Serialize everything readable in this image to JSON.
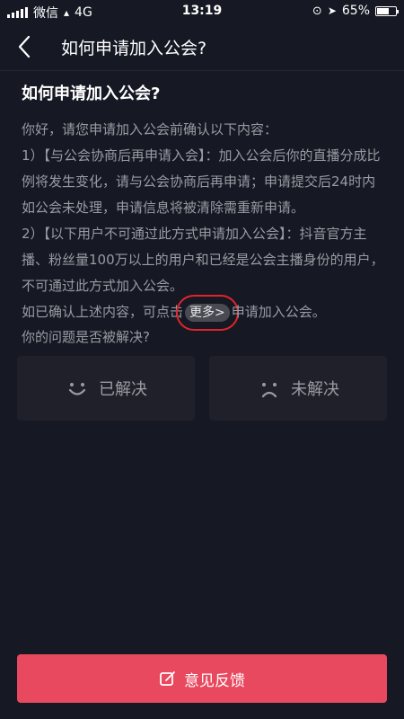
{
  "status_bar": {
    "carrier": "微信",
    "network": "4G",
    "time": "13:19",
    "battery": "65%",
    "battery_fraction": 0.65
  },
  "nav": {
    "title": "如何申请加入公会?"
  },
  "article": {
    "title": "如何申请加入公会?",
    "intro": "你好，请您申请加入公会前确认以下内容：",
    "item1": "1）【与公会协商后再申请入会】：加入公会后你的直播分成比例将发生变化，请与公会协商后再申请；申请提交后24时内如公会未处理，申请信息将被清除需重新申请。",
    "item2": "2）【以下用户不可通过此方式申请加入公会】：抖音官方主播、粉丝量100万以上的用户和已经是公会主播身份的用户，不可通过此方式加入公会。",
    "confirm_prefix": "如已确认上述内容，可点击",
    "more_link": "更多>",
    "confirm_suffix": "申请加入公会。"
  },
  "feedback": {
    "question": "你的问题是否被解决?",
    "resolved_label": "已解决",
    "unresolved_label": "未解决"
  },
  "bottom": {
    "button_label": "意见反馈"
  },
  "colors": {
    "background": "#161823",
    "accent": "#e8495e",
    "highlight_box": "#e0242b"
  }
}
